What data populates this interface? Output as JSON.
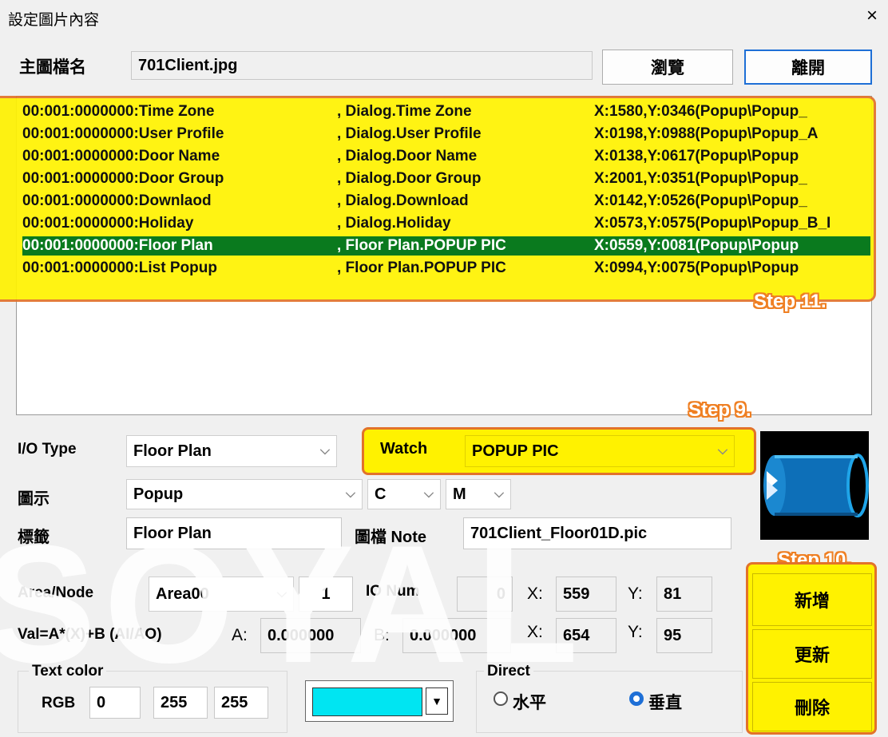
{
  "window": {
    "title": "設定圖片內容",
    "close_glyph": "×"
  },
  "file": {
    "label": "主圖檔名",
    "value": "701Client.jpg",
    "browse_label": "瀏覽",
    "exit_label": "離開"
  },
  "list": {
    "rows": [
      {
        "id": "00:001:0000000:Time Zone",
        "dialog": ", Dialog.Time Zone",
        "pos": "X:1580,Y:0346(Popup\\Popup_"
      },
      {
        "id": "00:001:0000000:User Profile",
        "dialog": ", Dialog.User Profile",
        "pos": "X:0198,Y:0988(Popup\\Popup_A"
      },
      {
        "id": "00:001:0000000:Door Name",
        "dialog": ", Dialog.Door Name",
        "pos": "X:0138,Y:0617(Popup\\Popup"
      },
      {
        "id": "00:001:0000000:Door Group",
        "dialog": ", Dialog.Door Group",
        "pos": "X:2001,Y:0351(Popup\\Popup_"
      },
      {
        "id": "00:001:0000000:Downlaod",
        "dialog": ", Dialog.Download",
        "pos": "X:0142,Y:0526(Popup\\Popup_"
      },
      {
        "id": "00:001:0000000:Holiday",
        "dialog": ", Dialog.Holiday",
        "pos": "X:0573,Y:0575(Popup\\Popup_B_I"
      },
      {
        "id": "00:001:0000000:Floor Plan",
        "dialog": ", Floor Plan.POPUP PIC",
        "pos": "X:0559,Y:0081(Popup\\Popup"
      },
      {
        "id": "00:001:0000000:List Popup",
        "dialog": ", Floor Plan.POPUP PIC",
        "pos": "X:0994,Y:0075(Popup\\Popup"
      }
    ],
    "selected_index": 6
  },
  "steps": {
    "s9": "Step 9.",
    "s10": "Step 10.",
    "s11": "Step 11."
  },
  "form": {
    "io_type_label": "I/O Type",
    "io_type_value": "Floor Plan",
    "watch_label": "Watch",
    "watch_value": "POPUP PIC",
    "icon_label": "圖示",
    "icon_value": "Popup",
    "c_value": "C",
    "m_value": "M",
    "tag_label": "標籤",
    "tag_value": "Floor Plan",
    "note_label": "圖檔 Note",
    "note_value": "701Client_Floor01D.pic",
    "area_label": "Area/Node",
    "area_value": "Area00",
    "node_value": "1",
    "io_num_label": "IO Num",
    "io_num_value": "0",
    "x1_label": "X:",
    "x1_value": "559",
    "y1_label": "Y:",
    "y1_value": "81",
    "val_label": "Val=A*(X)+B (AI/AO)",
    "a_label": "A:",
    "a_value": "0.000000",
    "b_label": "B:",
    "b_value": "0.000000",
    "x2_label": "X:",
    "x2_value": "654",
    "y2_label": "Y:",
    "y2_value": "95",
    "text_color_label": "Text color",
    "rgb_label": "RGB",
    "r_value": "0",
    "g_value": "255",
    "b2_value": "255",
    "color_swatch": "#00e5f2",
    "direct_label": "Direct",
    "horizontal_label": "水平",
    "vertical_label": "垂直",
    "direction_selected": "vertical"
  },
  "actions": {
    "add_label": "新增",
    "update_label": "更新",
    "delete_label": "刪除"
  },
  "watermark": "SOYAL",
  "colors": {
    "highlight": "#fff200",
    "outline": "#e2722a",
    "selected_row": "#0a7a1e",
    "accent": "#1e6fd6"
  }
}
